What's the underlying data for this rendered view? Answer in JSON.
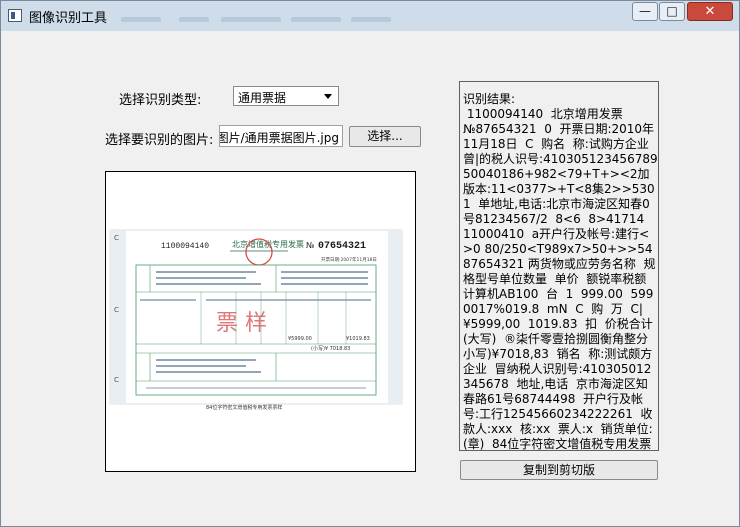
{
  "window": {
    "title": "图像识别工具",
    "controls": {
      "minimize": "—",
      "maximize": "□",
      "close": "✕"
    }
  },
  "form": {
    "type_label": "选择识别类型:",
    "type_value": "通用票据",
    "image_label": "选择要识别的图片:",
    "image_path": "图片/通用票据图片.jpg",
    "browse_button": "选择..."
  },
  "invoice": {
    "left_number": "1100094140",
    "title": "北京增值税专用发票",
    "no_prefix": "№",
    "number": "07654321",
    "date": "开票日期:2007年11月18日",
    "watermark": "票  样",
    "total_small": "¥5999.00",
    "total_tax": "¥1019.83",
    "total_sum": "(小写)¥ 7018.83",
    "footer": "84位字符密文增值税专用发票票样"
  },
  "result": {
    "text": "识别结果:\n 1100094140  北京增用发票\n№87654321  0  开票日期:2010年11月18日  C  购名  称:试购方企业曾|的税人识号:410305123456789 50040186+982<79+T+><2加版本:11<0377>+T<8集2>>5301  单地址,电话:北京市海淀区知春0号81234567/2  8<6  8>41714  11000410  a开户行及帐号:建行<>0 80/250<T989x7>50+>>5487654321 两货物或应劳务名称  规格型号单位数量  单价  额锐率税额  计算机AB100  台  1  999.00  5990017%019.8  mN  C  购  万  C|¥5999,00  1019.83  扣  价税合计(大写)  ®柒仟零壹拾捌圆衡角整分小写)¥7018,83  销名  称:测试颇方企业  冒纳税人识别号:410305012345678  地址,电话  京市海淀区知春路61号68744498  开户行及帐号:工行12545660234222261  收款人:xxx  核:xx  票人:x  销货单位:(章)  84位字符密文增值税专用发票票样",
    "copy_button": "复制到剪切版"
  }
}
